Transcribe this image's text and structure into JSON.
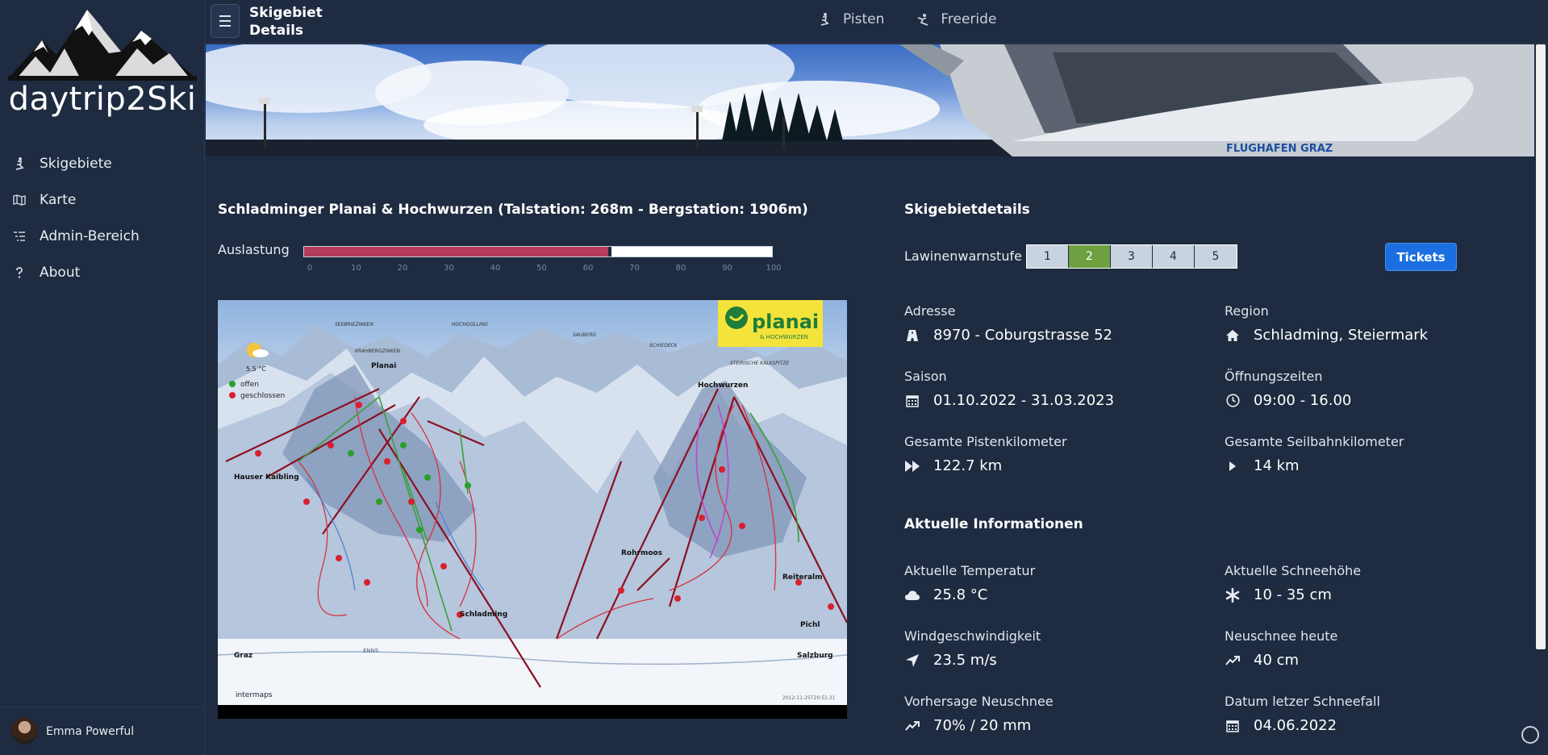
{
  "app": {
    "brand": "daytrip2Ski"
  },
  "sidebar": {
    "items": [
      {
        "label": "Skigebiete",
        "icon": "skier-icon"
      },
      {
        "label": "Karte",
        "icon": "map-icon"
      },
      {
        "label": "Admin-Bereich",
        "icon": "list-icon"
      },
      {
        "label": "About",
        "icon": "question-icon"
      }
    ],
    "user": {
      "name": "Emma Powerful"
    }
  },
  "topbar": {
    "title": "Skigebiet Details",
    "links": [
      {
        "label": "Pisten",
        "icon": "skier-icon"
      },
      {
        "label": "Freeride",
        "icon": "freeride-icon"
      }
    ]
  },
  "resort": {
    "title": "Schladminger Planai & Hochwurzen (Talstation: 268m - Bergstation: 1906m)",
    "load_label": "Auslastung",
    "load_percent": 65,
    "load_ticks": [
      "0",
      "10",
      "20",
      "30",
      "40",
      "50",
      "60",
      "70",
      "80",
      "90",
      "100"
    ]
  },
  "map": {
    "logo_text": "planai",
    "logo_sub": "& HOCHWURZEN",
    "legend_open": "offen",
    "legend_closed": "geschlossen",
    "weather": "5.5 °C",
    "peaks": [
      "SEEBRIEZINKEN",
      "HOCHGOLLING",
      "SAUBERG",
      "SCHIEDECK",
      "STEIRISCHE KALKSPITZE",
      "KRAHBERGZINKEN",
      "Planai",
      "Hochwurzen"
    ],
    "places": [
      "Hauser Kaibling",
      "Schladming",
      "Rohrmoos",
      "Reiteralm",
      "Pichl",
      "Graz",
      "Salzburg",
      "ENNS"
    ],
    "credit": "intermaps",
    "stamp": "2012-11-25T20:51:31"
  },
  "details": {
    "title": "Skigebietdetails",
    "avalanche_label": "Lawinenwarnstufe",
    "avalanche_levels": [
      "1",
      "2",
      "3",
      "4",
      "5"
    ],
    "avalanche_active": 2,
    "tickets_label": "Tickets",
    "fields": {
      "adresse": {
        "label": "Adresse",
        "value": "8970 - Coburgstrasse 52"
      },
      "region": {
        "label": "Region",
        "value": "Schladming, Steiermark"
      },
      "saison": {
        "label": "Saison",
        "value": "01.10.2022 - 31.03.2023"
      },
      "oeffnung": {
        "label": "Öffnungszeiten",
        "value": "09:00 - 16.00"
      },
      "pisten": {
        "label": "Gesamte Pistenkilometer",
        "value": "122.7 km"
      },
      "seilbahn": {
        "label": "Gesamte Seilbahnkilometer",
        "value": "14 km"
      }
    }
  },
  "info": {
    "title": "Aktuelle Informationen",
    "fields": {
      "temp": {
        "label": "Aktuelle Temperatur",
        "value": "25.8 °C"
      },
      "schnee": {
        "label": "Aktuelle Schneehöhe",
        "value": "10 - 35 cm"
      },
      "wind": {
        "label": "Windgeschwindigkeit",
        "value": "23.5 m/s"
      },
      "neuschnee": {
        "label": "Neuschnee heute",
        "value": "40 cm"
      },
      "vorhersage": {
        "label": "Vorhersage Neuschnee",
        "value": "70% / 20 mm"
      },
      "datum": {
        "label": "Datum letzer Schneefall",
        "value": "04.06.2022"
      }
    }
  },
  "banner": {
    "sign_text": "FLUGHAFEN GRAZ"
  },
  "colors": {
    "bg": "#1e2b40",
    "accent": "#1b6fe0",
    "load": "#b33d5a",
    "level_active": "#6ea041"
  }
}
